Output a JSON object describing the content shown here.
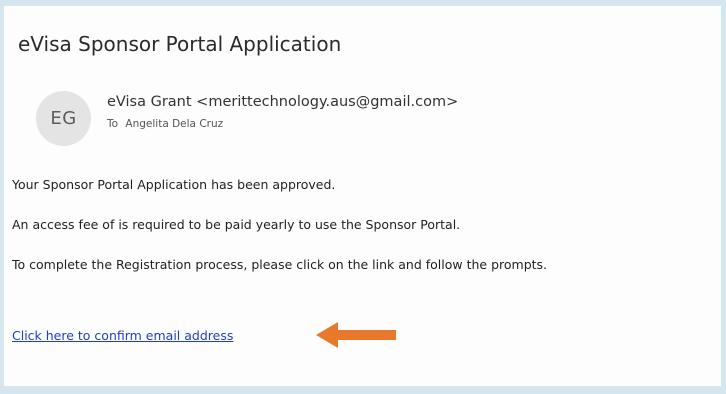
{
  "email": {
    "subject": "eVisa Sponsor Portal Application",
    "avatar_initials": "EG",
    "sender": "eVisa Grant <merittechnology.aus@gmail.com>",
    "to_label": "To",
    "recipient": "Angelita Dela Cruz",
    "body": {
      "line1": "Your Sponsor Portal Application has been approved.",
      "line2": "An access fee of is required to be paid yearly to use the Sponsor Portal.",
      "line3": "To complete the Registration process, please click on the link and follow the prompts."
    },
    "link_text": "Click here to confirm email address"
  },
  "colors": {
    "background": "#d5e6ef",
    "card": "#fdfdfd",
    "link": "#1f3ec4",
    "arrow": "#e8792b"
  },
  "icons": {
    "annotation": "left-arrow-icon"
  }
}
